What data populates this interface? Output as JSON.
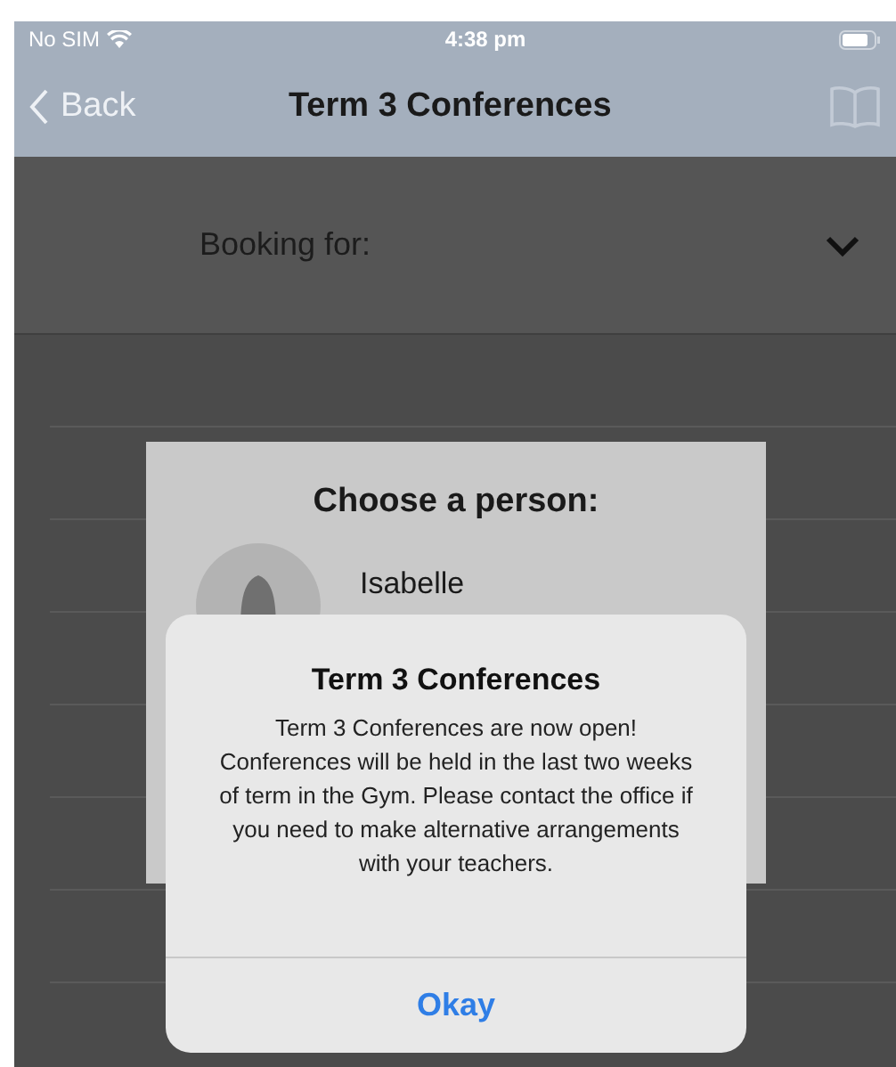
{
  "status_bar": {
    "carrier": "No SIM",
    "time": "4:38 pm"
  },
  "nav": {
    "back": "Back",
    "title": "Term 3 Conferences"
  },
  "booking": {
    "label": "Booking for:"
  },
  "picker": {
    "title": "Choose a person:",
    "people": [
      {
        "name": "Isabelle"
      }
    ]
  },
  "alert": {
    "title": "Term 3 Conferences",
    "message": "Term 3 Conferences are now open! Conferences will be held in the last two weeks of term in the Gym. Please contact the office if you need to make alternative arrangements with your teachers.",
    "buttons": [
      "Okay"
    ]
  }
}
